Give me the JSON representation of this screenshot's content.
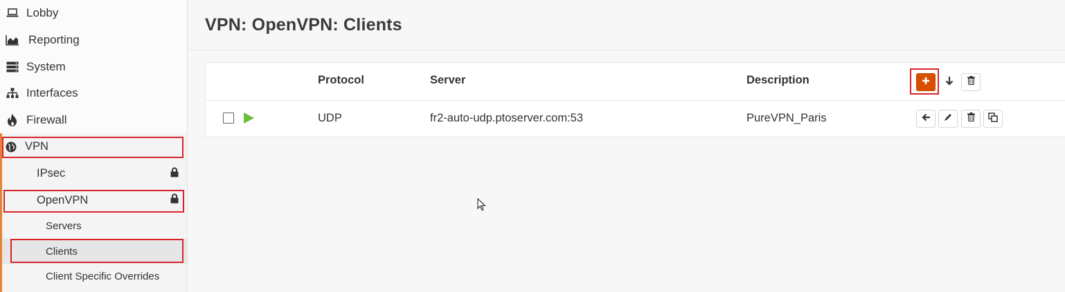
{
  "sidebar": {
    "items": [
      {
        "label": "Lobby",
        "icon": "laptop-icon"
      },
      {
        "label": "Reporting",
        "icon": "area-chart-icon"
      },
      {
        "label": "System",
        "icon": "server-icon"
      },
      {
        "label": "Interfaces",
        "icon": "sitemap-icon"
      },
      {
        "label": "Firewall",
        "icon": "fire-icon"
      },
      {
        "label": "VPN",
        "icon": "globe-icon"
      }
    ],
    "vpn_children": [
      {
        "label": "IPsec",
        "icon": "lock-icon"
      },
      {
        "label": "OpenVPN",
        "icon": "lock-icon"
      }
    ],
    "openvpn_children": [
      {
        "label": "Servers"
      },
      {
        "label": "Clients"
      },
      {
        "label": "Client Specific Overrides"
      }
    ]
  },
  "page": {
    "title": "VPN: OpenVPN: Clients"
  },
  "table": {
    "columns": [
      "Protocol",
      "Server",
      "Description"
    ],
    "rows": [
      {
        "protocol": "UDP",
        "server": "fr2-auto-udp.ptoserver.com:53",
        "description": "PureVPN_Paris",
        "enabled": true
      }
    ]
  },
  "colors": {
    "accent": "#d94f00",
    "sidebar_accent": "#e88336",
    "enabled": "#6cbf3c",
    "highlight": "#d8232a"
  }
}
